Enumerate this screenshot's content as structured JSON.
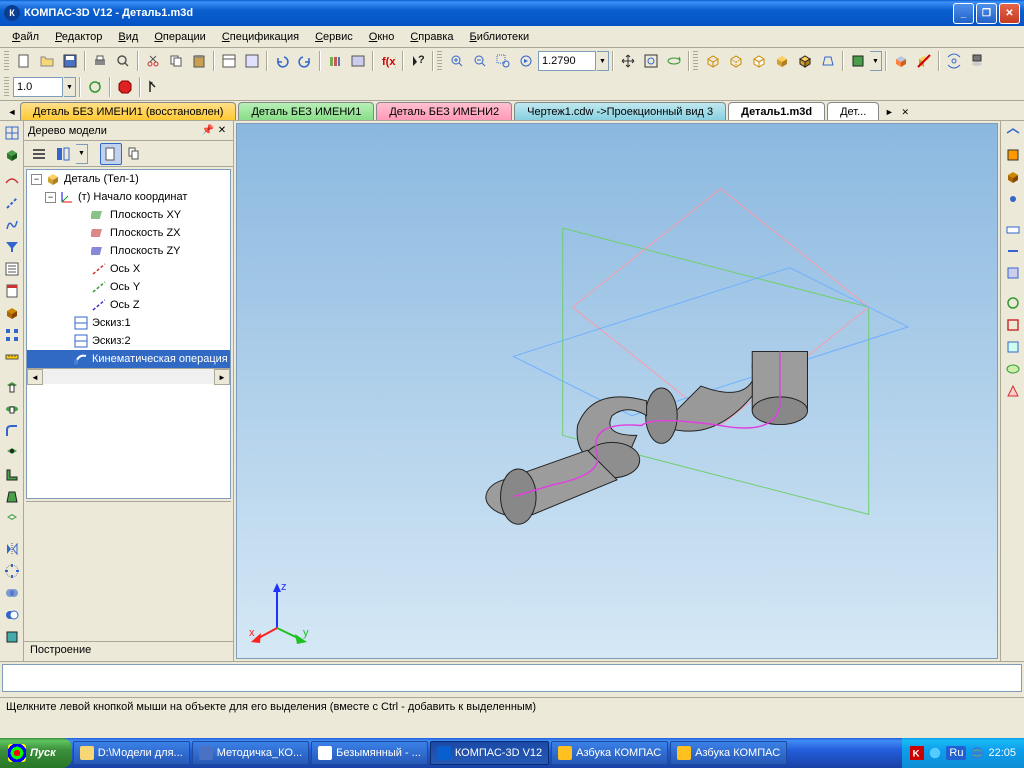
{
  "title": "КОМПАС-3D V12 - Деталь1.m3d",
  "menu": [
    "Файл",
    "Редактор",
    "Вид",
    "Операции",
    "Спецификация",
    "Сервис",
    "Окно",
    "Справка",
    "Библиотеки"
  ],
  "toolbar": {
    "scale_value": "1.0",
    "zoom_value": "1.2790"
  },
  "doctabs": [
    {
      "label": "Деталь БЕЗ ИМЕНИ1 (восстановлен)",
      "cls": "t0"
    },
    {
      "label": "Деталь БЕЗ ИМЕНИ1",
      "cls": "t1"
    },
    {
      "label": "Деталь БЕЗ ИМЕНИ2",
      "cls": "t2"
    },
    {
      "label": "Чертеж1.cdw ->Проекционный вид 3",
      "cls": "t3"
    },
    {
      "label": "Деталь1.m3d",
      "cls": "active"
    },
    {
      "label": "Дет...",
      "cls": "overflow"
    }
  ],
  "tree": {
    "title": "Дерево модели",
    "root": "Деталь (Тел-1)",
    "origin": "(т) Начало координат",
    "planes": [
      "Плоскость XY",
      "Плоскость ZX",
      "Плоскость ZY"
    ],
    "axes": [
      "Ось X",
      "Ось Y",
      "Ось Z"
    ],
    "sketches": [
      "Эскиз:1",
      "Эскиз:2"
    ],
    "op": "Кинематическая операция",
    "tab": "Построение"
  },
  "csys": {
    "x": "x",
    "y": "y",
    "z": "z"
  },
  "status": "Щелкните левой кнопкой мыши на объекте для его выделения (вместе с Ctrl - добавить к выделенным)",
  "taskbar": {
    "start": "Пуск",
    "items": [
      "D:\\Модели для...",
      "Методичка_КО...",
      "Безымянный - ...",
      "КОМПАС-3D V12",
      "Азбука КОМПАС",
      "Азбука КОМПАС"
    ],
    "lang": "Ru",
    "time": "22:05"
  }
}
